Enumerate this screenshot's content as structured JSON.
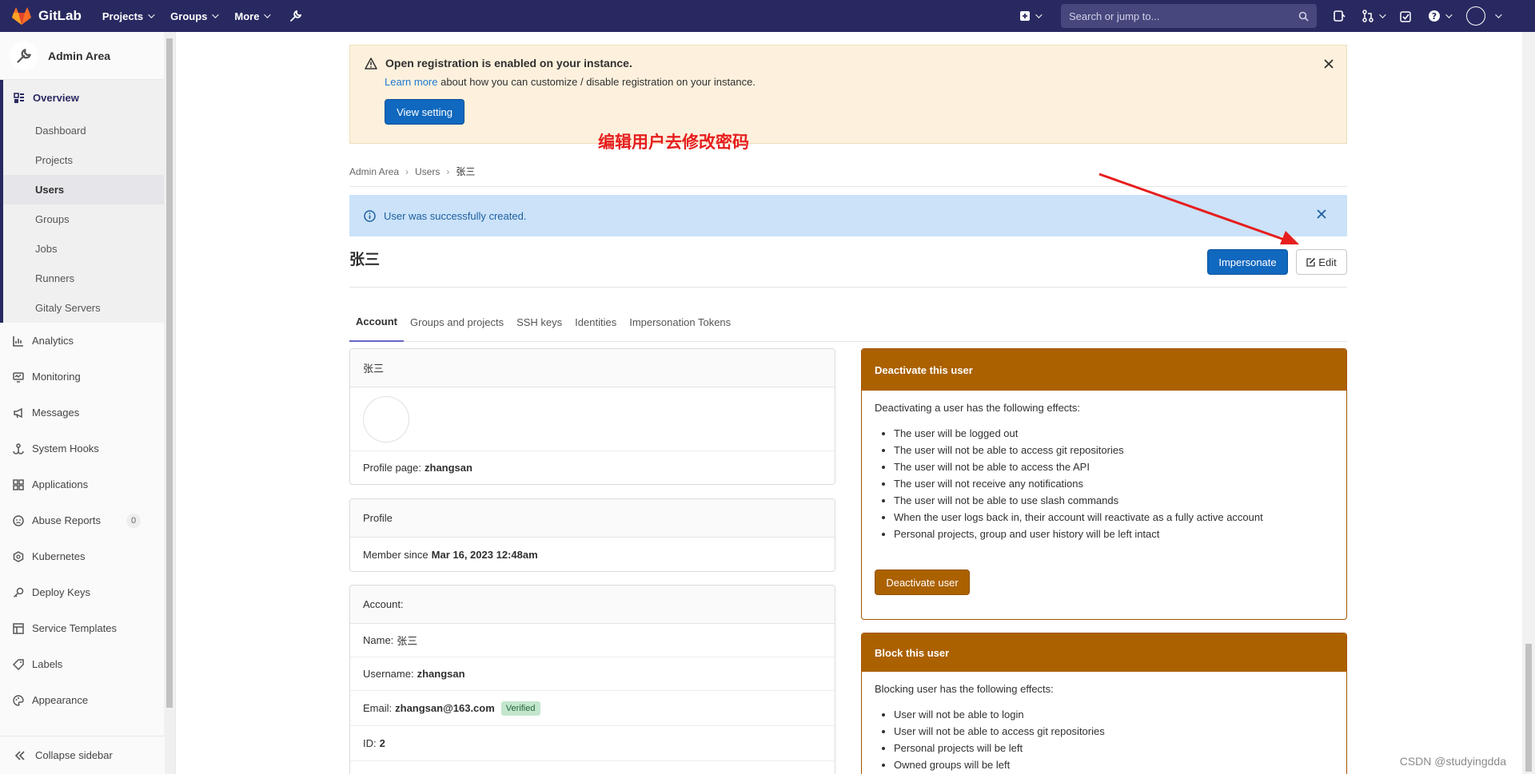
{
  "navbar": {
    "brand": "GitLab",
    "links": [
      "Projects",
      "Groups",
      "More"
    ],
    "search_placeholder": "Search or jump to..."
  },
  "sidebar": {
    "title": "Admin Area",
    "overview_label": "Overview",
    "overview_items": [
      "Dashboard",
      "Projects",
      "Users",
      "Groups",
      "Jobs",
      "Runners",
      "Gitaly Servers"
    ],
    "main_items": [
      {
        "label": "Analytics",
        "icon": "chart-icon"
      },
      {
        "label": "Monitoring",
        "icon": "monitor-icon"
      },
      {
        "label": "Messages",
        "icon": "bullhorn-icon"
      },
      {
        "label": "System Hooks",
        "icon": "hook-icon"
      },
      {
        "label": "Applications",
        "icon": "applications-icon"
      },
      {
        "label": "Abuse Reports",
        "icon": "abuse-icon",
        "badge": "0"
      },
      {
        "label": "Kubernetes",
        "icon": "kubernetes-icon"
      },
      {
        "label": "Deploy Keys",
        "icon": "key-icon"
      },
      {
        "label": "Service Templates",
        "icon": "template-icon"
      },
      {
        "label": "Labels",
        "icon": "label-icon"
      },
      {
        "label": "Appearance",
        "icon": "palette-icon"
      }
    ],
    "collapse_label": "Collapse sidebar"
  },
  "registration_alert": {
    "title": "Open registration is enabled on your instance.",
    "link": "Learn more",
    "desc": " about how you can customize / disable registration on your instance.",
    "button": "View setting"
  },
  "breadcrumb": [
    "Admin Area",
    "Users",
    "张三"
  ],
  "annotation": "编辑用户去修改密码",
  "success_alert": "User was successfully created.",
  "user": {
    "name": "张三",
    "impersonate": "Impersonate",
    "edit": "Edit"
  },
  "tabs": [
    "Account",
    "Groups and projects",
    "SSH keys",
    "Identities",
    "Impersonation Tokens"
  ],
  "profile_card": {
    "header": "张三",
    "profile_page_label": "Profile page:",
    "profile_page_value": "zhangsan"
  },
  "profile2_card": {
    "header": "Profile",
    "member_label": "Member since",
    "member_value": "Mar 16, 2023 12:48am"
  },
  "account_card": {
    "header": "Account:",
    "name_label": "Name:",
    "name_value": "张三",
    "username_label": "Username:",
    "username_value": "zhangsan",
    "email_label": "Email:",
    "email_value": "zhangsan@163.com",
    "verified": "Verified",
    "id_label": "ID:",
    "id_value": "2"
  },
  "deactivate_card": {
    "header": "Deactivate this user",
    "intro": "Deactivating a user has the following effects:",
    "effects": [
      "The user will be logged out",
      "The user will not be able to access git repositories",
      "The user will not be able to access the API",
      "The user will not receive any notifications",
      "The user will not be able to use slash commands",
      "When the user logs back in, their account will reactivate as a fully active account",
      "Personal projects, group and user history will be left intact"
    ],
    "button": "Deactivate user"
  },
  "block_card": {
    "header": "Block this user",
    "intro": "Blocking user has the following effects:",
    "effects": [
      "User will not be able to login",
      "User will not be able to access git repositories",
      "Personal projects will be left",
      "Owned groups will be left"
    ]
  },
  "watermark": "CSDN @studyingdda",
  "colors": {
    "navbar": "#292961",
    "primary": "#1068bf",
    "warning": "#ab6100",
    "annotation": "#e61e1e"
  }
}
